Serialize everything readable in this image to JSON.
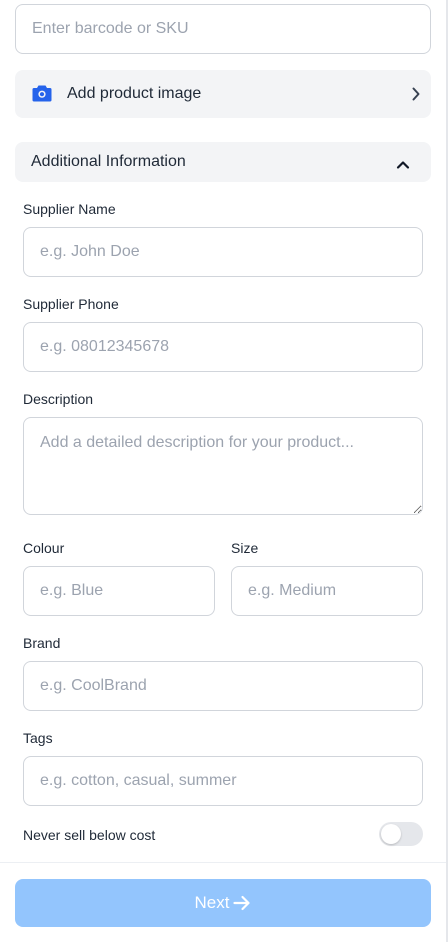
{
  "barcode": {
    "placeholder": "Enter barcode or SKU"
  },
  "product_image": {
    "label": "Add product image",
    "icon": "camera-icon",
    "accent": "#2563eb"
  },
  "additional_info": {
    "title": "Additional Information",
    "icon": "chevron-up-icon"
  },
  "supplier_name": {
    "label": "Supplier Name",
    "placeholder": "e.g. John Doe"
  },
  "supplier_phone": {
    "label": "Supplier Phone",
    "placeholder": "e.g. 08012345678"
  },
  "description": {
    "label": "Description",
    "placeholder": "Add a detailed description for your product..."
  },
  "colour": {
    "label": "Colour",
    "placeholder": "e.g. Blue"
  },
  "size": {
    "label": "Size",
    "placeholder": "e.g. Medium"
  },
  "brand": {
    "label": "Brand",
    "placeholder": "e.g. CoolBrand"
  },
  "tags": {
    "label": "Tags",
    "placeholder": "e.g. cotton, casual, summer"
  },
  "never_sell_below_cost": {
    "label": "Never sell below cost",
    "enabled": false
  },
  "next_button": {
    "label": "Next",
    "icon": "arrow-right-icon",
    "color": "#93c5fd"
  }
}
